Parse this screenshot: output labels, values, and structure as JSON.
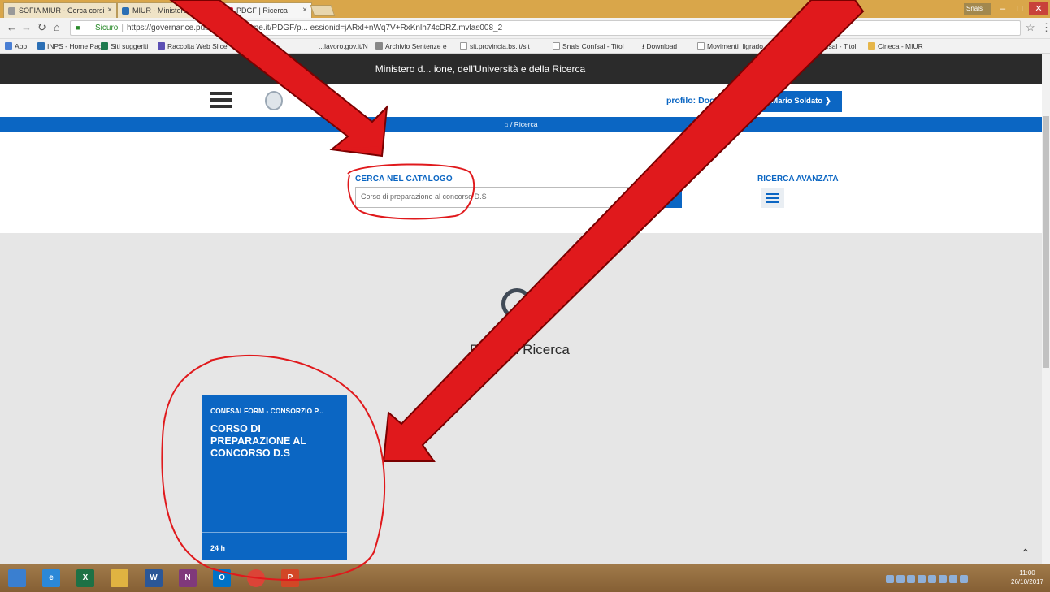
{
  "browser": {
    "tabs": [
      {
        "label": "SOFIA MIUR - Cerca corsi",
        "active": false
      },
      {
        "label": "MIUR - Ministero dell'Istr",
        "active": false
      },
      {
        "label": "PDGF | Ricerca",
        "active": true
      }
    ],
    "user_chip": "Snals",
    "address": {
      "secure_label": "Sicuro",
      "url": "https://governance.pubblica.istruzione.it/PDGF/p... essionid=jARxI+nWq7V+RxKnlh74cDRZ.mvlas008_2"
    },
    "bookmarks": [
      {
        "label": "App",
        "color": "#4a7fd4"
      },
      {
        "label": "INPS - Home Page",
        "color": "#2b6fb5"
      },
      {
        "label": "Siti suggeriti",
        "color": "#1e7a4f"
      },
      {
        "label": "Raccolta Web Slice",
        "color": "#5b4fb4"
      },
      {
        "label": "Importati d...",
        "color": "#e6b64a"
      },
      {
        "label": "...lavoro.gov.it/N",
        "color": "#cccccc"
      },
      {
        "label": "Archivio Sentenze e",
        "color": "#888888"
      },
      {
        "label": "sit.provincia.bs.it/sit",
        "color": "#bbbbbb"
      },
      {
        "label": "Snals Confsal - Titol",
        "color": "#bbbbbb"
      },
      {
        "label": "Download",
        "color": "#333333"
      },
      {
        "label": "Movimenti_ligrado.",
        "color": "#bbbbbb"
      },
      {
        "label": "...fsal - Titol",
        "color": "#bbbbbb"
      },
      {
        "label": "Cineca - MIUR",
        "color": "#e6b64a"
      }
    ]
  },
  "page": {
    "ministry_title": "Ministero d... ione, dell'Università e della Ricerca",
    "profile_label": "profilo: Doc",
    "user_button": "Mario Soldato",
    "breadcrumb": "Ricerca",
    "search": {
      "label": "CERCA NEL CATALOGO",
      "value": "Corso di preparazione al concorso D.S",
      "advanced_label": "RICERCA AVANZATA"
    },
    "results_title": "Risultati Ricerca",
    "card": {
      "org": "CONFSALFORM - CONSORZIO P...",
      "title": "CORSO DI PREPARAZIONE AL CONCORSO D.S",
      "hours": "24 h"
    }
  },
  "taskbar": {
    "apps": [
      {
        "label": "",
        "name": "windows-start-icon",
        "color": "#3a7fd0"
      },
      {
        "label": "e",
        "name": "internet-explorer-icon",
        "color": "#2b88d8"
      },
      {
        "label": "X",
        "name": "excel-icon",
        "color": "#1e7145"
      },
      {
        "label": "",
        "name": "file-explorer-icon",
        "color": "#e0b341"
      },
      {
        "label": "W",
        "name": "word-icon",
        "color": "#2b5797"
      },
      {
        "label": "N",
        "name": "onenote-icon",
        "color": "#80397b"
      },
      {
        "label": "O",
        "name": "outlook-icon",
        "color": "#0072c6"
      },
      {
        "label": "",
        "name": "chrome-icon",
        "color": "#db4437"
      },
      {
        "label": "P",
        "name": "powerpoint-icon",
        "color": "#d24726"
      }
    ],
    "clock_time": "11:00",
    "clock_date": "26/10/2017"
  },
  "colors": {
    "accent": "#0b66c3",
    "annotation": "#e0191c"
  }
}
